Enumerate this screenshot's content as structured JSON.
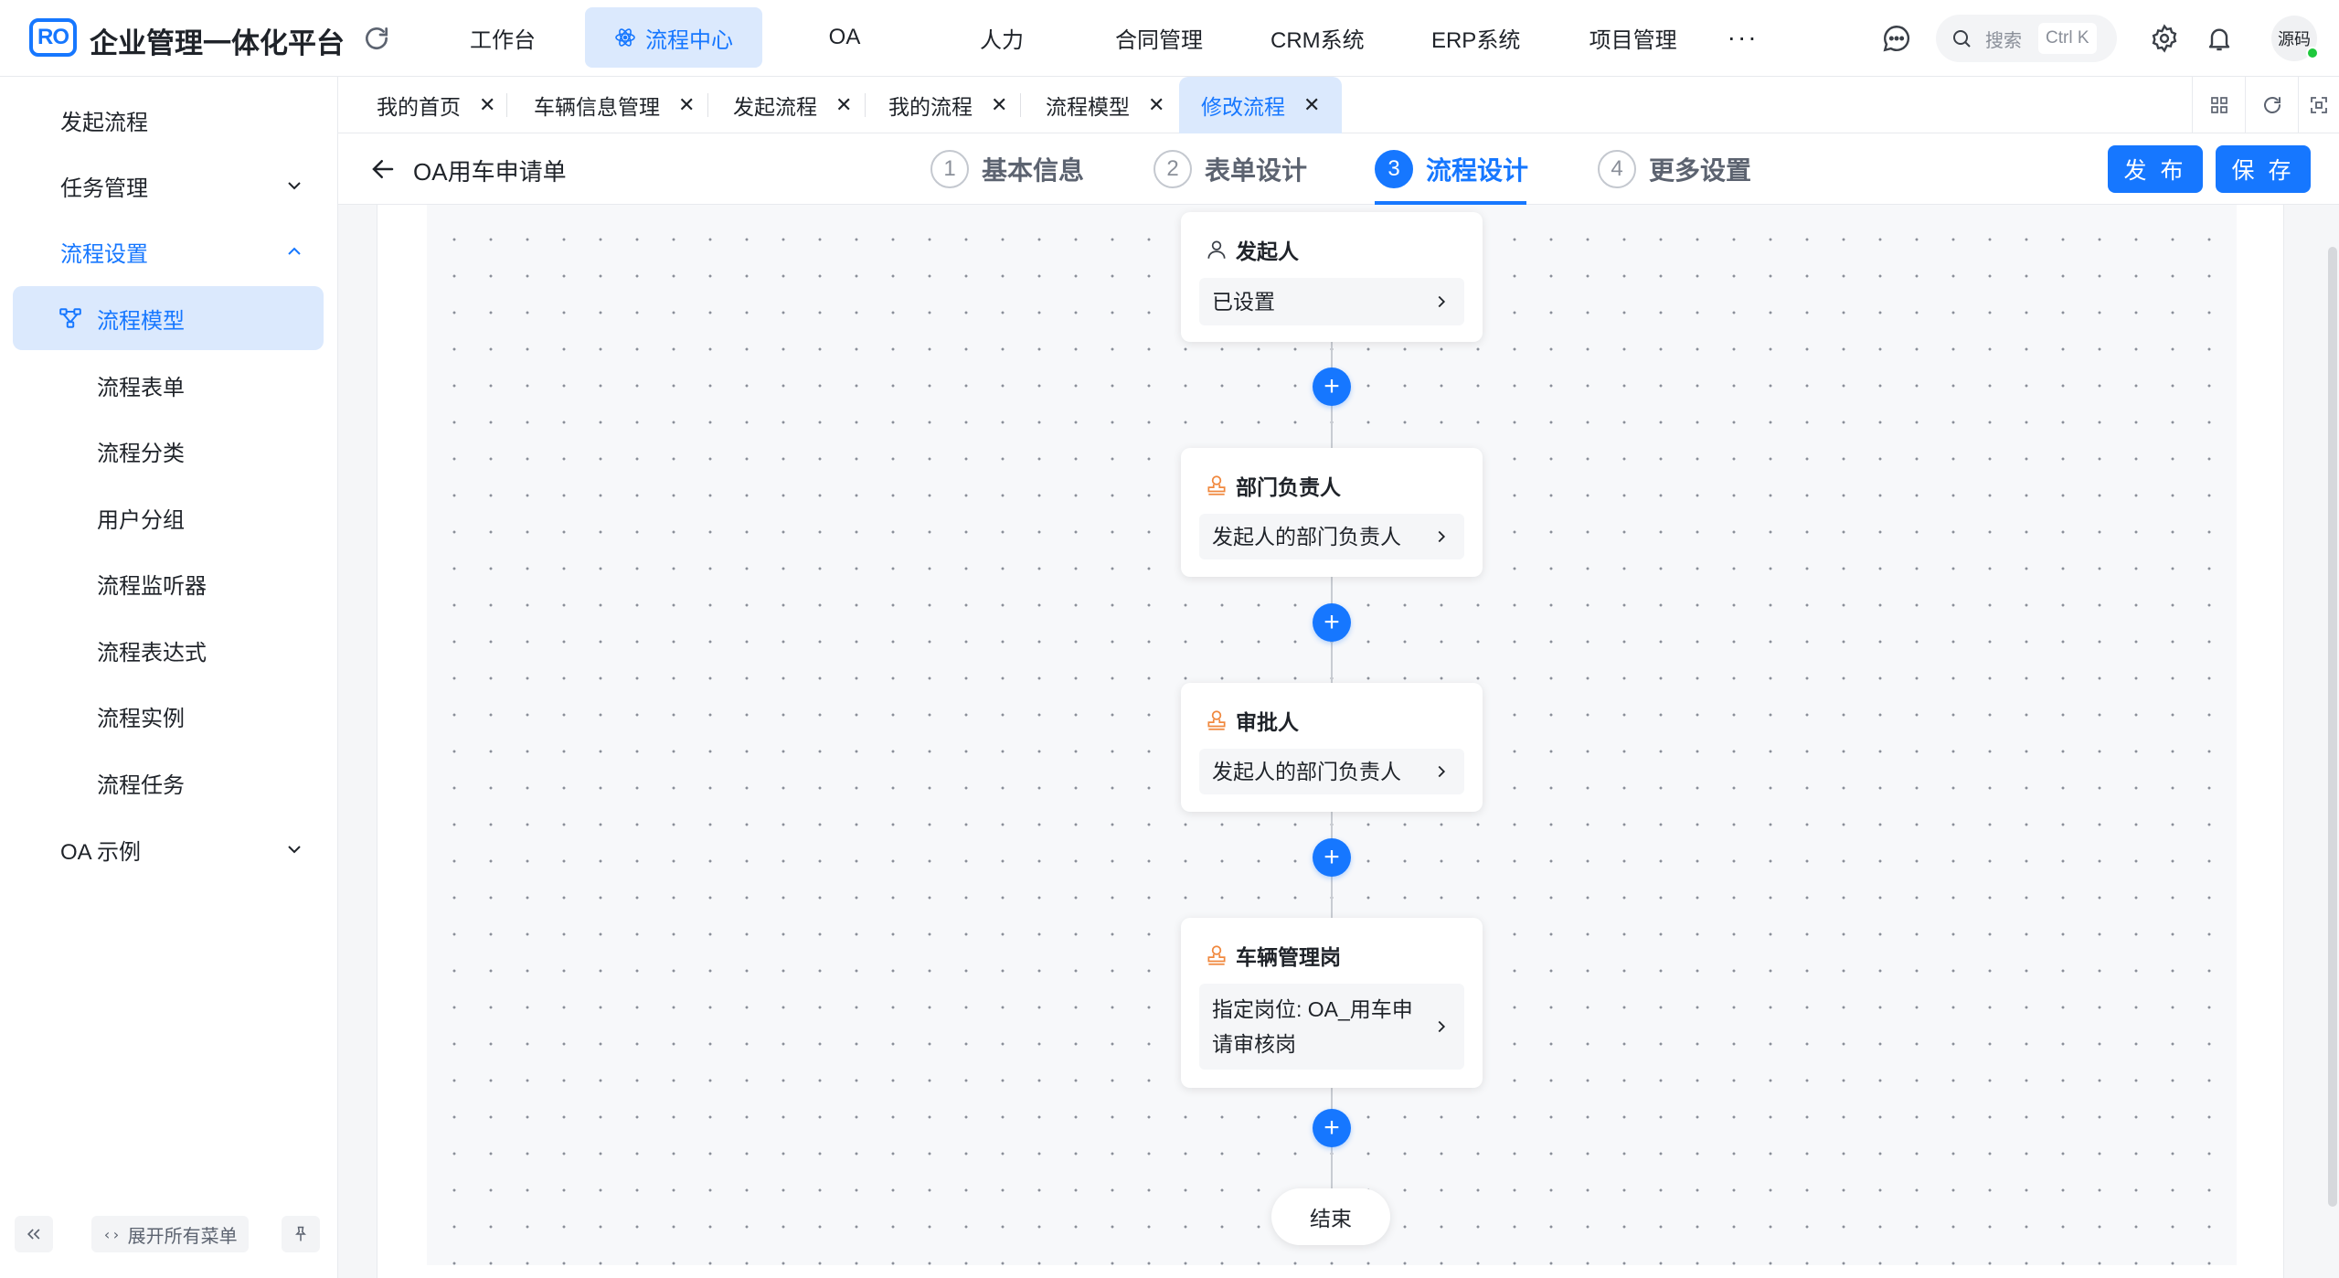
{
  "app": {
    "logo": "RO",
    "title": "企业管理一体化平台"
  },
  "nav": {
    "items": [
      {
        "label": "工作台",
        "active": false
      },
      {
        "label": "流程中心",
        "active": true
      },
      {
        "label": "OA",
        "active": false
      },
      {
        "label": "人力",
        "active": false
      },
      {
        "label": "合同管理",
        "active": false
      },
      {
        "label": "CRM系统",
        "active": false
      },
      {
        "label": "ERP系统",
        "active": false
      },
      {
        "label": "项目管理",
        "active": false
      }
    ],
    "more": "···"
  },
  "header_right": {
    "search_placeholder": "搜索",
    "search_shortcut": "Ctrl K",
    "user": "源码"
  },
  "sidebar": {
    "items": [
      {
        "label": "发起流程"
      },
      {
        "label": "任务管理"
      },
      {
        "label": "流程设置"
      },
      {
        "label": "流程模型"
      },
      {
        "label": "流程表单"
      },
      {
        "label": "流程分类"
      },
      {
        "label": "用户分组"
      },
      {
        "label": "流程监听器"
      },
      {
        "label": "流程表达式"
      },
      {
        "label": "流程实例"
      },
      {
        "label": "流程任务"
      },
      {
        "label": "OA 示例"
      }
    ],
    "expand_all": "展开所有菜单"
  },
  "tabs": [
    {
      "label": "我的首页"
    },
    {
      "label": "车辆信息管理"
    },
    {
      "label": "发起流程"
    },
    {
      "label": "我的流程"
    },
    {
      "label": "流程模型"
    },
    {
      "label": "修改流程"
    }
  ],
  "editor": {
    "form_title": "OA用车申请单",
    "steps": [
      {
        "num": "1",
        "label": "基本信息"
      },
      {
        "num": "2",
        "label": "表单设计"
      },
      {
        "num": "3",
        "label": "流程设计"
      },
      {
        "num": "4",
        "label": "更多设置"
      }
    ],
    "active_step": 3,
    "publish_label": "发 布",
    "save_label": "保 存"
  },
  "flow": {
    "nodes": [
      {
        "title": "发起人",
        "detail": "已设置",
        "icon": "user-icon"
      },
      {
        "title": "部门负责人",
        "detail": "发起人的部门负责人",
        "icon": "approver-stamp-icon"
      },
      {
        "title": "审批人",
        "detail": "发起人的部门负责人",
        "icon": "approver-stamp-icon"
      },
      {
        "title": "车辆管理岗",
        "detail": "指定岗位: OA_用车申请审核岗",
        "icon": "approver-stamp-icon"
      }
    ],
    "add_symbol": "+",
    "end_label": "结束"
  },
  "colors": {
    "accent": "#1677ff",
    "accent_bg": "#dbe9fd",
    "approver_icon": "#f0883e"
  }
}
